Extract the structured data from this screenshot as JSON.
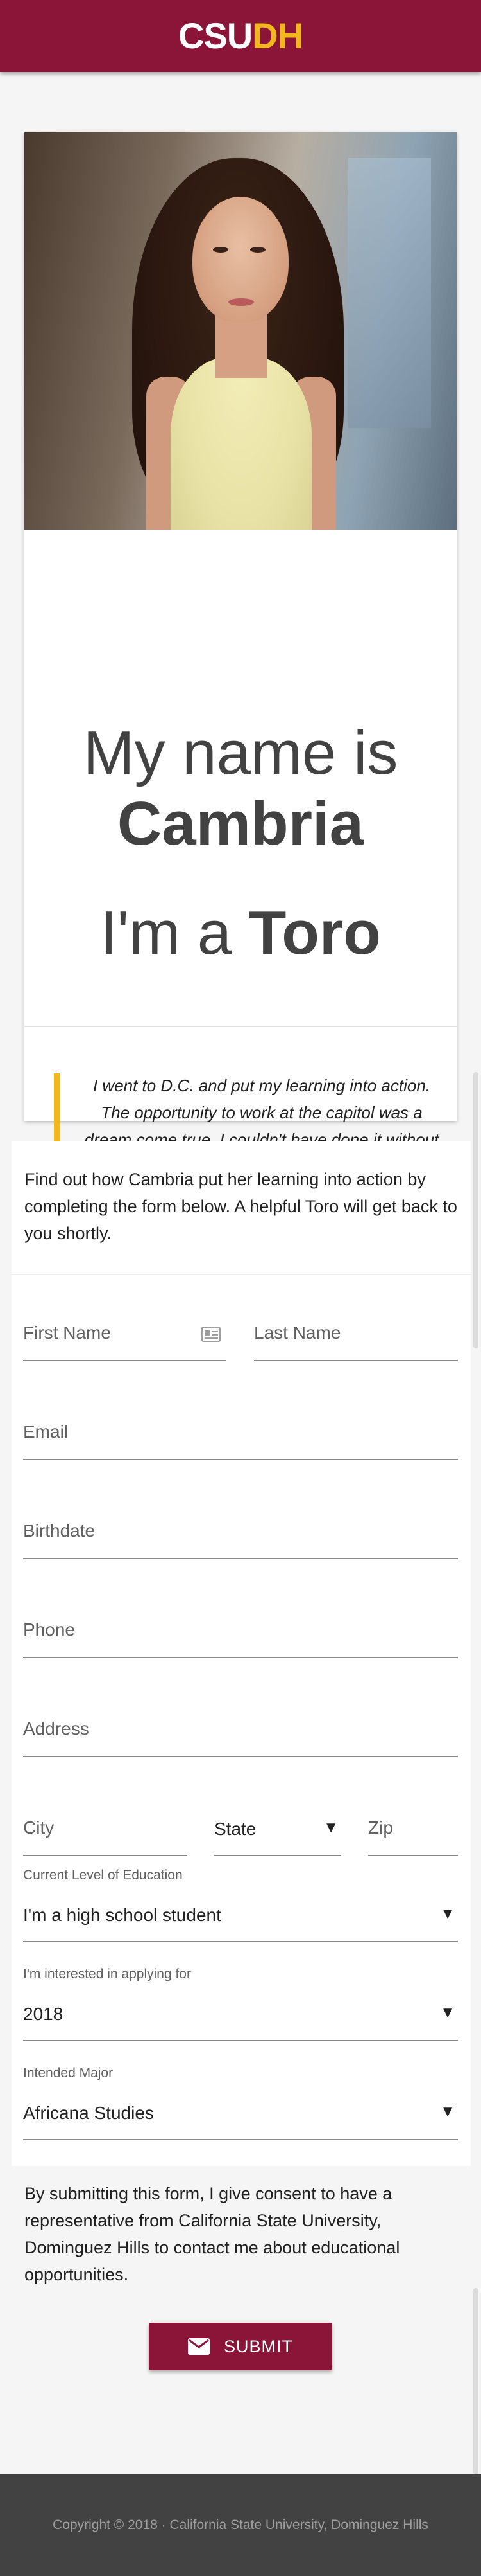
{
  "header": {
    "logo_part1": "CSU",
    "logo_part2": "DH"
  },
  "profile": {
    "photo_alt": "Portrait photo",
    "intro_line1": "My name is",
    "name": "Cambria",
    "intro_line3_prefix": "I'm a",
    "intro_line3_bold": "Toro",
    "quote": "I went to D.C. and put my learning into action. The opportunity to work at the capitol was a dream come true. I couldn't have done it without CSUDH. The community support is second to none."
  },
  "form": {
    "lead": "Find out how Cambria put her learning into action by completing the form below. A helpful Toro will get back to you shortly.",
    "first_name_label": "First Name",
    "last_name_label": "Last Name",
    "email_label": "Email",
    "birthdate_label": "Birthdate",
    "phone_label": "Phone",
    "address_label": "Address",
    "city_label": "City",
    "state_label": "State",
    "zip_label": "Zip",
    "education_caption": "Current Level of Education",
    "education_value": "I'm a high school student",
    "applying_caption": "I'm interested in applying for",
    "applying_value": "2018",
    "major_caption": "Intended Major",
    "major_value": "Africana Studies",
    "dropdown_arrow": "▼"
  },
  "consent": "By submitting this form, I give consent to have a representative from California State University, Dominguez Hills to contact me about educational opportunities.",
  "submit_label": "SUBMIT",
  "footer": {
    "copyright": "Copyright © 2018 · California State University, Dominguez Hills"
  },
  "colors": {
    "brand": "#8a1538",
    "gold": "#f2b71c",
    "footer": "#424242"
  },
  "icons": [
    "contact-card-icon",
    "mail-icon",
    "dropdown-arrow-icon"
  ]
}
